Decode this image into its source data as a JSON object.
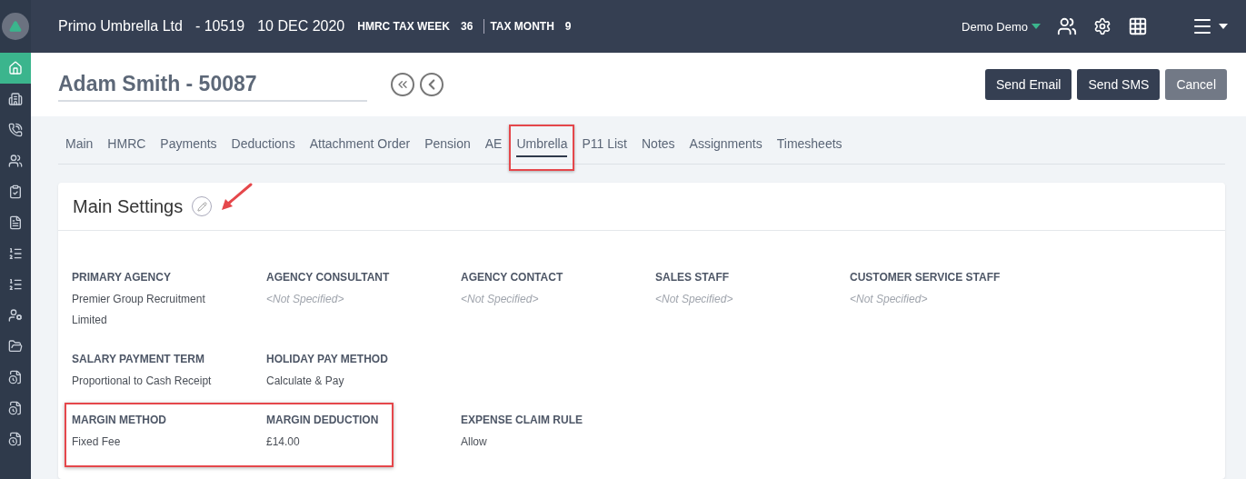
{
  "header": {
    "company": "Primo Umbrella Ltd",
    "company_id": "- 10519",
    "date": "10 DEC 2020",
    "tax_week_label": "HMRC TAX WEEK",
    "tax_week": "36",
    "tax_month_label": "TAX MONTH",
    "tax_month": "9",
    "user": "Demo Demo"
  },
  "sidebar": {
    "items": [
      {
        "kind": "home",
        "selected": true
      },
      {
        "kind": "building",
        "selected": false
      },
      {
        "kind": "phone",
        "selected": false
      },
      {
        "kind": "users",
        "selected": false
      },
      {
        "kind": "clipboard",
        "selected": false
      },
      {
        "kind": "doc",
        "selected": false
      },
      {
        "kind": "list",
        "selected": false
      },
      {
        "kind": "list",
        "selected": false
      },
      {
        "kind": "worker",
        "selected": false
      },
      {
        "kind": "folder",
        "selected": false
      },
      {
        "kind": "file",
        "selected": false
      },
      {
        "kind": "file",
        "selected": false
      },
      {
        "kind": "file",
        "selected": false
      }
    ]
  },
  "employee": {
    "title": "Adam Smith - 50087"
  },
  "buttons": [
    {
      "label": "Send Email",
      "kind": "primary"
    },
    {
      "label": "Send SMS",
      "kind": "primary"
    },
    {
      "label": "Cancel",
      "kind": "secondary"
    }
  ],
  "tabs": [
    {
      "label": "Main",
      "selected": false,
      "highlighted": false
    },
    {
      "label": "HMRC",
      "selected": false,
      "highlighted": false
    },
    {
      "label": "Payments",
      "selected": false,
      "highlighted": false
    },
    {
      "label": "Deductions",
      "selected": false,
      "highlighted": false
    },
    {
      "label": "Attachment Order",
      "selected": false,
      "highlighted": false
    },
    {
      "label": "Pension",
      "selected": false,
      "highlighted": false
    },
    {
      "label": "AE",
      "selected": false,
      "highlighted": false
    },
    {
      "label": "Umbrella",
      "selected": true,
      "highlighted": true
    },
    {
      "label": "P11 List",
      "selected": false,
      "highlighted": false
    },
    {
      "label": "Notes",
      "selected": false,
      "highlighted": false
    },
    {
      "label": "Assignments",
      "selected": false,
      "highlighted": false
    },
    {
      "label": "Timesheets",
      "selected": false,
      "highlighted": false
    }
  ],
  "card": {
    "title": "Main Settings",
    "edit_pointed": true,
    "rows": [
      {
        "groups": [
          {
            "highlighted": false,
            "fields": [
              {
                "label": "PRIMARY AGENCY",
                "value": "Premier Group Recruitment Limited",
                "specified": true
              },
              {
                "label": "AGENCY CONSULTANT",
                "value": "<Not Specified>",
                "specified": false
              },
              {
                "label": "AGENCY CONTACT",
                "value": "<Not Specified>",
                "specified": false
              },
              {
                "label": "SALES STAFF",
                "value": "<Not Specified>",
                "specified": false
              },
              {
                "label": "CUSTOMER SERVICE STAFF",
                "value": "<Not Specified>",
                "specified": false
              }
            ]
          }
        ]
      },
      {
        "groups": [
          {
            "highlighted": false,
            "fields": [
              {
                "label": "SALARY PAYMENT TERM",
                "value": "Proportional to Cash Receipt",
                "specified": true
              },
              {
                "label": "HOLIDAY PAY METHOD",
                "value": "Calculate & Pay",
                "specified": true
              }
            ]
          }
        ]
      },
      {
        "groups": [
          {
            "highlighted": true,
            "fields": [
              {
                "label": "MARGIN METHOD",
                "value": "Fixed Fee",
                "specified": true
              },
              {
                "label": "MARGIN DEDUCTION",
                "value": "£14.00",
                "specified": true
              }
            ]
          },
          {
            "highlighted": false,
            "fields": [
              {
                "label": "EXPENSE CLAIM RULE",
                "value": "Allow",
                "specified": true
              }
            ]
          }
        ]
      }
    ]
  }
}
